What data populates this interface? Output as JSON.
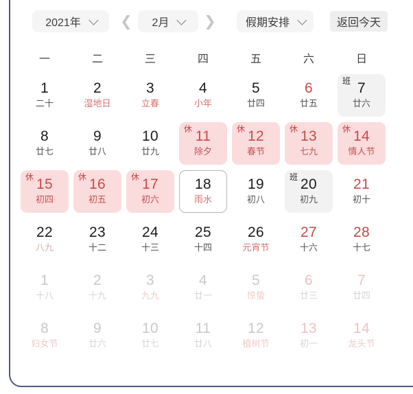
{
  "toolbar": {
    "year_label": "2021年",
    "month_label": "2月",
    "holiday_label": "假期安排",
    "today_label": "返回今天",
    "prev_icon": "chevron-left-icon",
    "next_icon": "chevron-right-icon",
    "dropdown_icon": "chevron-down-icon"
  },
  "weekdays": [
    "一",
    "二",
    "三",
    "四",
    "五",
    "六",
    "日"
  ],
  "badges": {
    "rest": "休",
    "work": "班"
  },
  "colors": {
    "rest_bg": "#fbdcdc",
    "rest_text": "#c94a4a",
    "work_bg": "#f2f2f2",
    "today_border": "#b4b4b4",
    "card_border": "#4d5a80",
    "pill_bg": "#f5f5f5",
    "today_btn_bg": "#eeeeee",
    "muted_text": "#c9c9c9"
  },
  "weeks": [
    [
      {
        "day": "1",
        "sub": "二十",
        "sub_style": "plain",
        "num_style": "plain",
        "state": "normal",
        "badge": ""
      },
      {
        "day": "2",
        "sub": "湿地日",
        "sub_style": "red",
        "num_style": "plain",
        "state": "normal",
        "badge": ""
      },
      {
        "day": "3",
        "sub": "立春",
        "sub_style": "red",
        "num_style": "plain",
        "state": "normal",
        "badge": ""
      },
      {
        "day": "4",
        "sub": "小年",
        "sub_style": "red",
        "num_style": "plain",
        "state": "normal",
        "badge": ""
      },
      {
        "day": "5",
        "sub": "廿四",
        "sub_style": "plain",
        "num_style": "plain",
        "state": "normal",
        "badge": ""
      },
      {
        "day": "6",
        "sub": "廿五",
        "sub_style": "plain",
        "num_style": "red",
        "state": "normal",
        "badge": ""
      },
      {
        "day": "7",
        "sub": "廿六",
        "sub_style": "plain",
        "num_style": "plain",
        "state": "work",
        "badge": "班"
      }
    ],
    [
      {
        "day": "8",
        "sub": "廿七",
        "sub_style": "plain",
        "num_style": "plain",
        "state": "normal",
        "badge": ""
      },
      {
        "day": "9",
        "sub": "廿八",
        "sub_style": "plain",
        "num_style": "plain",
        "state": "normal",
        "badge": ""
      },
      {
        "day": "10",
        "sub": "廿九",
        "sub_style": "plain",
        "num_style": "plain",
        "state": "normal",
        "badge": ""
      },
      {
        "day": "11",
        "sub": "除夕",
        "sub_style": "plain",
        "num_style": "plain",
        "state": "rest",
        "badge": "休"
      },
      {
        "day": "12",
        "sub": "春节",
        "sub_style": "plain",
        "num_style": "plain",
        "state": "rest",
        "badge": "休"
      },
      {
        "day": "13",
        "sub": "七九",
        "sub_style": "plain",
        "num_style": "plain",
        "state": "rest",
        "badge": "休"
      },
      {
        "day": "14",
        "sub": "情人节",
        "sub_style": "plain",
        "num_style": "plain",
        "state": "rest",
        "badge": "休"
      }
    ],
    [
      {
        "day": "15",
        "sub": "初四",
        "sub_style": "plain",
        "num_style": "plain",
        "state": "rest",
        "badge": "休"
      },
      {
        "day": "16",
        "sub": "初五",
        "sub_style": "plain",
        "num_style": "plain",
        "state": "rest",
        "badge": "休"
      },
      {
        "day": "17",
        "sub": "初六",
        "sub_style": "plain",
        "num_style": "plain",
        "state": "rest",
        "badge": "休"
      },
      {
        "day": "18",
        "sub": "雨水",
        "sub_style": "red",
        "num_style": "plain",
        "state": "today",
        "badge": ""
      },
      {
        "day": "19",
        "sub": "初八",
        "sub_style": "plain",
        "num_style": "plain",
        "state": "normal",
        "badge": ""
      },
      {
        "day": "20",
        "sub": "初九",
        "sub_style": "plain",
        "num_style": "plain",
        "state": "work",
        "badge": "班"
      },
      {
        "day": "21",
        "sub": "初十",
        "sub_style": "plain",
        "num_style": "red",
        "state": "normal",
        "badge": ""
      }
    ],
    [
      {
        "day": "22",
        "sub": "八九",
        "sub_style": "pinkish",
        "num_style": "plain",
        "state": "normal",
        "badge": ""
      },
      {
        "day": "23",
        "sub": "十二",
        "sub_style": "plain",
        "num_style": "plain",
        "state": "normal",
        "badge": ""
      },
      {
        "day": "24",
        "sub": "十三",
        "sub_style": "plain",
        "num_style": "plain",
        "state": "normal",
        "badge": ""
      },
      {
        "day": "25",
        "sub": "十四",
        "sub_style": "plain",
        "num_style": "plain",
        "state": "normal",
        "badge": ""
      },
      {
        "day": "26",
        "sub": "元宵节",
        "sub_style": "red",
        "num_style": "plain",
        "state": "normal",
        "badge": ""
      },
      {
        "day": "27",
        "sub": "十六",
        "sub_style": "plain",
        "num_style": "red",
        "state": "normal",
        "badge": ""
      },
      {
        "day": "28",
        "sub": "十七",
        "sub_style": "plain",
        "num_style": "red",
        "state": "normal",
        "badge": ""
      }
    ],
    [
      {
        "day": "1",
        "sub": "十八",
        "sub_style": "plain",
        "num_style": "plain",
        "state": "muted",
        "badge": ""
      },
      {
        "day": "2",
        "sub": "十九",
        "sub_style": "plain",
        "num_style": "plain",
        "state": "muted",
        "badge": ""
      },
      {
        "day": "3",
        "sub": "九九",
        "sub_style": "red",
        "num_style": "plain",
        "state": "muted",
        "badge": ""
      },
      {
        "day": "4",
        "sub": "廿一",
        "sub_style": "plain",
        "num_style": "plain",
        "state": "muted",
        "badge": ""
      },
      {
        "day": "5",
        "sub": "惊蛰",
        "sub_style": "red",
        "num_style": "plain",
        "state": "muted",
        "badge": ""
      },
      {
        "day": "6",
        "sub": "廿三",
        "sub_style": "plain",
        "num_style": "red",
        "state": "muted",
        "badge": ""
      },
      {
        "day": "7",
        "sub": "廿四",
        "sub_style": "plain",
        "num_style": "red",
        "state": "muted",
        "badge": ""
      }
    ],
    [
      {
        "day": "8",
        "sub": "妇女节",
        "sub_style": "red",
        "num_style": "plain",
        "state": "muted",
        "badge": ""
      },
      {
        "day": "9",
        "sub": "廿六",
        "sub_style": "plain",
        "num_style": "plain",
        "state": "muted",
        "badge": ""
      },
      {
        "day": "10",
        "sub": "廿七",
        "sub_style": "plain",
        "num_style": "plain",
        "state": "muted",
        "badge": ""
      },
      {
        "day": "11",
        "sub": "廿八",
        "sub_style": "plain",
        "num_style": "plain",
        "state": "muted",
        "badge": ""
      },
      {
        "day": "12",
        "sub": "植树节",
        "sub_style": "red",
        "num_style": "plain",
        "state": "muted",
        "badge": ""
      },
      {
        "day": "13",
        "sub": "初一",
        "sub_style": "plain",
        "num_style": "red",
        "state": "muted",
        "badge": ""
      },
      {
        "day": "14",
        "sub": "龙头节",
        "sub_style": "red",
        "num_style": "red",
        "state": "muted",
        "badge": ""
      }
    ]
  ]
}
